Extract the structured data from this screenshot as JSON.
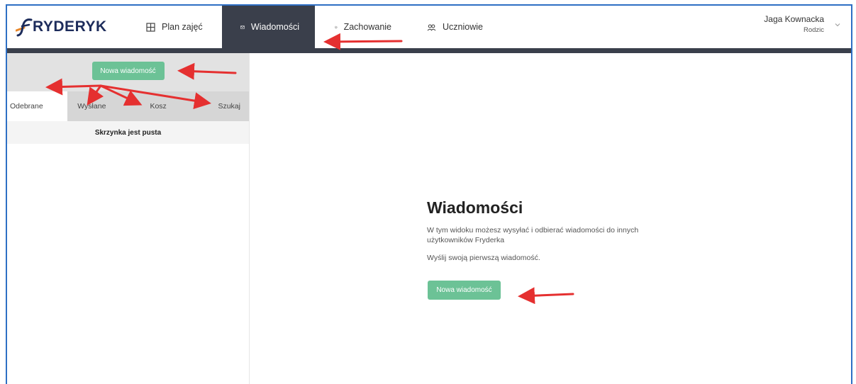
{
  "app": {
    "logo_text": "RYDERYK",
    "logo_letter": "F"
  },
  "nav": {
    "items": [
      {
        "label": "Plan zajęć",
        "icon": "grid-icon"
      },
      {
        "label": "Wiadomości",
        "icon": "mail-icon",
        "active": true
      },
      {
        "label": "Zachowanie",
        "icon": "smiley-icon"
      },
      {
        "label": "Uczniowie",
        "icon": "people-icon"
      }
    ]
  },
  "user": {
    "name": "Jaga Kownacka",
    "role": "Rodzic"
  },
  "left_panel": {
    "new_message_label": "Nowa wiadomość",
    "tabs": [
      {
        "label": "Odebrane",
        "active": true
      },
      {
        "label": "Wysłane"
      },
      {
        "label": "Kosz"
      },
      {
        "label": "Szukaj"
      }
    ],
    "empty_text": "Skrzynka jest pusta"
  },
  "main": {
    "title": "Wiadomości",
    "description": "W tym widoku możesz wysyłać i odbierać wiadomości do innych użytkowników Fryderka",
    "cta_text": "Wyślij swoją pierwszą wiadomość.",
    "button_label": "Nowa wiadomość"
  },
  "colors": {
    "accent_green": "#6cc296",
    "nav_dark": "#3a3f4b",
    "brand_navy": "#1d2c5b",
    "brand_orange": "#e8872a",
    "annotation_red": "#e53030"
  }
}
